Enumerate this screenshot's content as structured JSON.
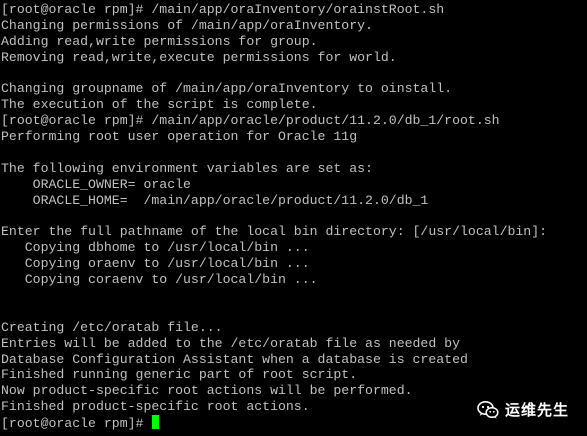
{
  "terminal": {
    "lines": [
      "[root@oracle rpm]# /main/app/oraInventory/orainstRoot.sh",
      "Changing permissions of /main/app/oraInventory.",
      "Adding read,write permissions for group.",
      "Removing read,write,execute permissions for world.",
      "",
      "Changing groupname of /main/app/oraInventory to oinstall.",
      "The execution of the script is complete.",
      "[root@oracle rpm]# /main/app/oracle/product/11.2.0/db_1/root.sh",
      "Performing root user operation for Oracle 11g",
      "",
      "The following environment variables are set as:",
      "    ORACLE_OWNER= oracle",
      "    ORACLE_HOME=  /main/app/oracle/product/11.2.0/db_1",
      "",
      "Enter the full pathname of the local bin directory: [/usr/local/bin]:",
      "   Copying dbhome to /usr/local/bin ...",
      "   Copying oraenv to /usr/local/bin ...",
      "   Copying coraenv to /usr/local/bin ...",
      "",
      "",
      "Creating /etc/oratab file...",
      "Entries will be added to the /etc/oratab file as needed by",
      "Database Configuration Assistant when a database is created",
      "Finished running generic part of root script.",
      "Now product-specific root actions will be performed.",
      "Finished product-specific root actions."
    ],
    "prompt": "[root@oracle rpm]# ",
    "colors": {
      "background": "#000000",
      "text": "#c0c0c0",
      "cursor": "#00ff00"
    }
  },
  "watermark": {
    "text": "运维先生",
    "icon": "wechat-icon"
  }
}
